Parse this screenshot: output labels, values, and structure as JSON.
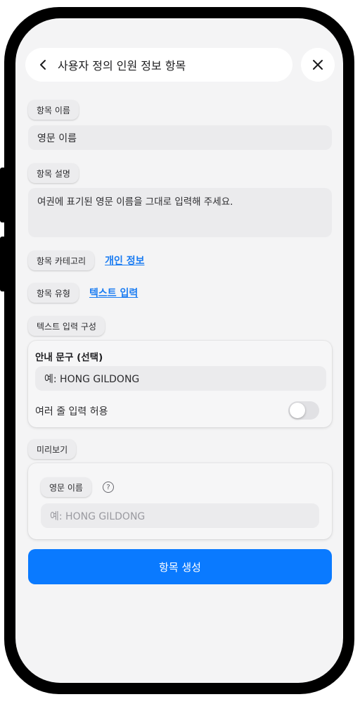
{
  "header": {
    "title": "사용자 정의 인원 정보 항목"
  },
  "form": {
    "name_label": "항목 이름",
    "name_value": "영문 이름",
    "description_label": "항목 설명",
    "description_value": "여권에 표기된 영문 이름을 그대로 입력해 주세요.",
    "category_label": "항목 카테고리",
    "category_value": "개인 정보",
    "type_label": "항목 유형",
    "type_value": "텍스트 입력",
    "config_label": "텍스트 입력 구성"
  },
  "config": {
    "guide_title": "안내 문구 (선택)",
    "guide_value": "예: HONG GILDONG",
    "multiline_label": "여러 줄 입력 허용",
    "multiline_enabled": false
  },
  "preview": {
    "label": "미리보기",
    "field_label": "영문 이름",
    "field_placeholder": "예: HONG GILDONG"
  },
  "actions": {
    "create_label": "항목 생성"
  },
  "colors": {
    "accent": "#0a7aff",
    "link": "#1a7cf2",
    "background": "#f4f4f5"
  }
}
